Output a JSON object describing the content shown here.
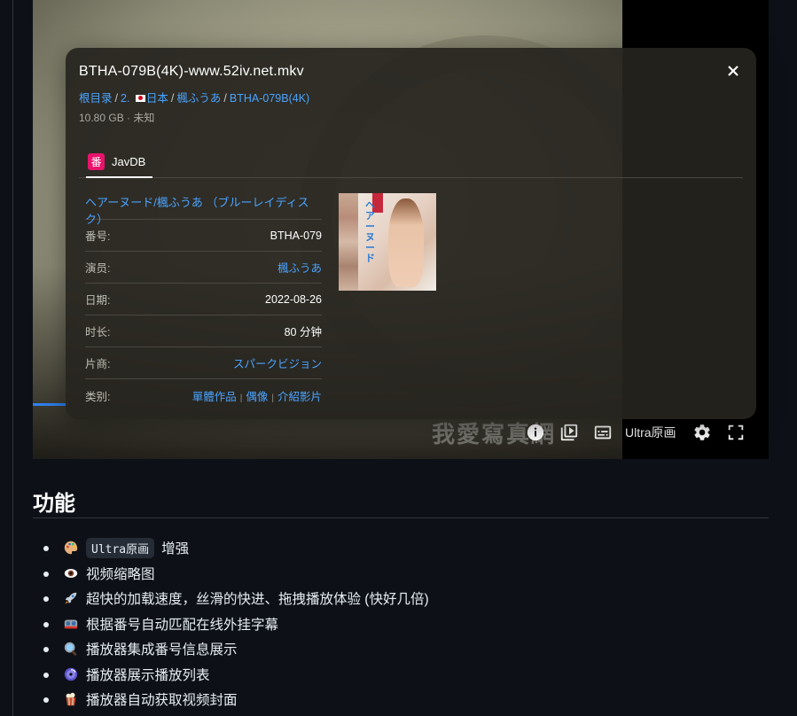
{
  "player": {
    "watermark": "我愛寫真網",
    "progress_fraction": 0.06,
    "controls": {
      "info_icon": "info-circle-icon",
      "playlist_icon": "playlist-icon",
      "subtitle_icon": "subtitles-icon",
      "quality_label": "Ultra原画",
      "settings_icon": "gear-icon",
      "fullscreen_icon": "fullscreen-icon"
    }
  },
  "info_panel": {
    "file_title": "BTHA-079B(4K)-www.52iv.net.mkv",
    "breadcrumb": [
      {
        "label": "根目录"
      },
      {
        "label": "2. ",
        "flag": "jp-flag-icon",
        "label_after_flag": "日本"
      },
      {
        "label": "楓ふうあ"
      },
      {
        "label": "BTHA-079B(4K)"
      }
    ],
    "breadcrumb_separator": "/",
    "file_meta": "10.80 GB · 未知",
    "tabs": [
      {
        "icon_glyph": "番",
        "icon_color": "#e8136c",
        "label": "JavDB"
      }
    ],
    "detail_title": "ヘアーヌード/楓ふうあ （ブルーレイディスク）",
    "rows": [
      {
        "key": "番号:",
        "value": "BTHA-079",
        "link": false
      },
      {
        "key": "演员:",
        "value": "楓ふうあ",
        "link": true
      },
      {
        "key": "日期:",
        "value": "2022-08-26",
        "link": false
      },
      {
        "key": "时长:",
        "value": "80 分钟",
        "link": false
      },
      {
        "key": "片商:",
        "value": "スパークビジョン",
        "link": true
      }
    ],
    "genre_row": {
      "key": "类别:",
      "values": [
        "單體作品",
        "偶像",
        "介紹影片"
      ]
    },
    "cover_text": "ヘアーヌード"
  },
  "readme": {
    "heading": "功能",
    "features": [
      {
        "emoji": "palette-icon",
        "code": "Ultra原画",
        "text": "增强"
      },
      {
        "emoji": "eye-icon",
        "text": "视频缩略图"
      },
      {
        "emoji": "rocket-icon",
        "text": "超快的加载速度，丝滑的快进、拖拽播放体验 (快好几倍)"
      },
      {
        "emoji": "goggles-icon",
        "text": "根据番号自动匹配在线外挂字幕"
      },
      {
        "emoji": "magnifier-icon",
        "text": "播放器集成番号信息展示"
      },
      {
        "emoji": "disc-icon",
        "text": "播放器展示播放列表"
      },
      {
        "emoji": "popcorn-icon",
        "text": "播放器自动获取视频封面"
      }
    ]
  },
  "colors": {
    "page_bg": "#0d1117",
    "link": "#4aa3ff",
    "panel_bg": "#26241e",
    "javdb_badge": "#e8136c",
    "progress": "#2f80ed"
  }
}
